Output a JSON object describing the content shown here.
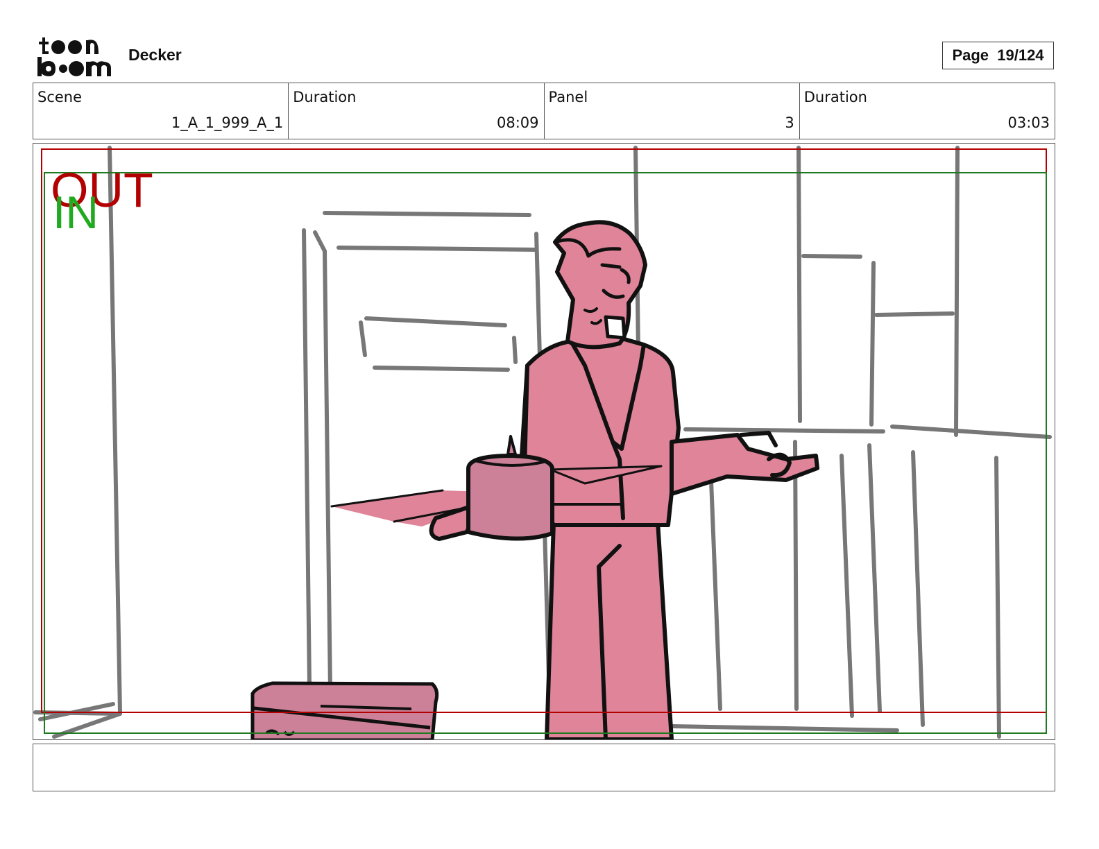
{
  "header": {
    "logo_text": "toonboom",
    "project_title": "Decker",
    "page_label": "Page  19/124"
  },
  "info": [
    {
      "label": "Scene",
      "value": "1_A_1_999_A_1"
    },
    {
      "label": "Duration",
      "value": "08:09"
    },
    {
      "label": "Panel",
      "value": "3"
    },
    {
      "label": "Duration",
      "value": "03:03"
    }
  ],
  "panel": {
    "out_label": "OUT",
    "in_label": "IN",
    "out_color": "#b30000",
    "in_color": "#1faa1f",
    "character_fill": "#df8499"
  },
  "notes": ""
}
